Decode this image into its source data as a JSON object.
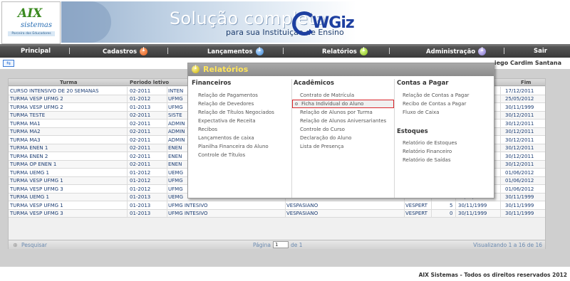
{
  "header": {
    "logo_main": "AIX",
    "logo_sub": "sistemas",
    "logo_tagline": "Parceira dos Educadores",
    "banner_title": "Solução completa",
    "banner_subtitle": "para sua Instituição de Ensino",
    "brand_logo": "WGiz"
  },
  "nav": {
    "items": [
      {
        "label": "Principal"
      },
      {
        "label": "Cadastros",
        "icon": "orange-arrow-icon"
      },
      {
        "label": "Lançamentos",
        "icon": "blue-arrow-icon"
      },
      {
        "label": "Relatórios",
        "icon": "green-arrow-icon"
      },
      {
        "label": "Administração",
        "icon": "purple-arrow-icon"
      },
      {
        "label": "Sair"
      }
    ],
    "separator": "|"
  },
  "subbar": {
    "expand_icon": "⇆",
    "user": "iego Cardim Santana"
  },
  "grid": {
    "columns": [
      "Turma",
      "Periodo letivo",
      "Fim"
    ],
    "rows": [
      {
        "turma": "CURSO INTENSIVO DE 20 SEMANAS",
        "periodo": "02-2011",
        "c3": "INTEN",
        "c4": "",
        "c5": "",
        "c6": "",
        "c7": "",
        "fim": "17/12/2011"
      },
      {
        "turma": "TURMA VESP UFMG 2",
        "periodo": "01-2012",
        "c3": "UFMG",
        "c4": "",
        "c5": "",
        "c6": "",
        "c7": "",
        "fim": "25/05/2012"
      },
      {
        "turma": "TURMA VESP UFMG 2",
        "periodo": "01-2013",
        "c3": "UFMG",
        "c4": "",
        "c5": "",
        "c6": "",
        "c7": "",
        "fim": "30/11/1999"
      },
      {
        "turma": "TURMA TESTE",
        "periodo": "02-2011",
        "c3": "SISTE",
        "c4": "",
        "c5": "",
        "c6": "",
        "c7": "",
        "fim": "30/12/2011"
      },
      {
        "turma": "TURMA MA1",
        "periodo": "02-2011",
        "c3": "ADMIN",
        "c4": "",
        "c5": "",
        "c6": "",
        "c7": "",
        "fim": "30/12/2011"
      },
      {
        "turma": "TURMA MA2",
        "periodo": "02-2011",
        "c3": "ADMIN",
        "c4": "",
        "c5": "",
        "c6": "",
        "c7": "",
        "fim": "30/12/2011"
      },
      {
        "turma": "TURMA MA3",
        "periodo": "02-2011",
        "c3": "ADMIN",
        "c4": "",
        "c5": "",
        "c6": "",
        "c7": "",
        "fim": "30/12/2011"
      },
      {
        "turma": "TURMA ENEN 1",
        "periodo": "02-2011",
        "c3": "ENEN",
        "c4": "",
        "c5": "",
        "c6": "",
        "c7": "",
        "fim": "30/12/2011"
      },
      {
        "turma": "TURMA ENEN 2",
        "periodo": "02-2011",
        "c3": "ENEN",
        "c4": "",
        "c5": "",
        "c6": "",
        "c7": "",
        "fim": "30/12/2011"
      },
      {
        "turma": "TURMA OP ENEN 1",
        "periodo": "02-2011",
        "c3": "ENEN",
        "c4": "",
        "c5": "",
        "c6": "",
        "c7": "",
        "fim": "30/12/2011"
      },
      {
        "turma": "TURMA UEMG 1",
        "periodo": "01-2012",
        "c3": "UEMG",
        "c4": "",
        "c5": "",
        "c6": "",
        "c7": "",
        "fim": "01/06/2012"
      },
      {
        "turma": "TURMA VESP UFMG 1",
        "periodo": "01-2012",
        "c3": "UFMG",
        "c4": "",
        "c5": "",
        "c6": "",
        "c7": "",
        "fim": "01/06/2012"
      },
      {
        "turma": "TURMA VESP UFMG 3",
        "periodo": "01-2012",
        "c3": "UFMG",
        "c4": "",
        "c5": "",
        "c6": "",
        "c7": "",
        "fim": "01/06/2012"
      },
      {
        "turma": "TURMA UEMG 1",
        "periodo": "01-2013",
        "c3": "UEMG",
        "c4": "MARIANA",
        "c5": "VESPERT",
        "c6": "4",
        "c7": "30/11/1999",
        "fim": "30/11/1999"
      },
      {
        "turma": "TURMA VESP UFMG 1",
        "periodo": "01-2013",
        "c3": "UFMG INTESIVO",
        "c4": "VESPASIANO",
        "c5": "VESPERT",
        "c6": "5",
        "c7": "30/11/1999",
        "fim": "30/11/1999"
      },
      {
        "turma": "TURMA VESP UFMG 3",
        "periodo": "01-2013",
        "c3": "UFMG INTESIVO",
        "c4": "VESPASIANO",
        "c5": "VESPERT",
        "c6": "0",
        "c7": "30/11/1999",
        "fim": "30/11/1999"
      }
    ]
  },
  "pager": {
    "search_label": "Pesquisar",
    "page_label": "Página",
    "page_value": "1",
    "of_label": "de 1",
    "view_label": "Visualizando 1 a 16 de 16"
  },
  "footer": {
    "text": "AIX Sistemas - Todos os direitos reservados 2012"
  },
  "menu": {
    "title": "Relatórios",
    "columns": [
      {
        "header": "Financeiros",
        "items": [
          "Relação de Pagamentos",
          "Relação de Devedores",
          "Relação de Títulos Negociados",
          "Expectativa de Receita",
          "Recibos",
          "Lançamentos de caixa",
          "Planilha Financeira do Aluno",
          "Controle de Títulos"
        ]
      },
      {
        "header": "Acadêmicos",
        "items": [
          "Contrato de Matrícula",
          "Ficha Individual do Aluno",
          "Relação de Alunos por Turma",
          "Relação de Alunos Aniversariantes",
          "Controle do Curso",
          "Declaração do Aluno",
          "Lista de Presença"
        ]
      },
      {
        "header": "Contas a Pagar",
        "items": [
          "Relação de Contas a Pagar",
          "Recibo de Contas a Pagar",
          "Fluxo de Caixa"
        ]
      },
      {
        "header": "Estoques",
        "items": [
          "Relatório de Estoques",
          "Relatório Financeiro",
          "Relatório de Saídas"
        ]
      }
    ],
    "selected_item": "Ficha Individual do Aluno"
  }
}
